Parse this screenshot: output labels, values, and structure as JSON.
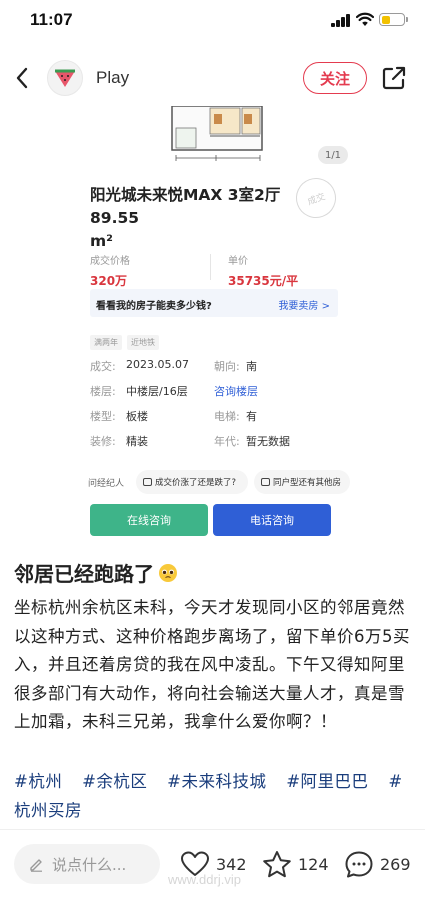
{
  "status_bar": {
    "time": "11:07",
    "battery_level": 0.38,
    "battery_color": "#f2c100"
  },
  "nav": {
    "back_icon": "chevron-left-icon",
    "avatar_icon": "watermelon-icon",
    "author": "Play",
    "follow_label": "关注",
    "share_icon": "share-icon",
    "accent_color": "#e43b4f"
  },
  "post_image": {
    "counter": "1/1",
    "title_line1": "阳光城未来悦MAX 3室2厅 89.55",
    "title_line2": "m²",
    "deal_price_label": "成交价格",
    "deal_price": "320万",
    "unit_price_label": "单价",
    "unit_price": "35735元/平",
    "banner_text": "看看我的房子能卖多少钱?",
    "banner_link": "我要卖房 >",
    "tags": [
      "满两年",
      "近地铁"
    ],
    "details": [
      {
        "label": "成交:",
        "value": "2023.05.07",
        "label2": "朝向:",
        "value2": "南"
      },
      {
        "label": "楼层:",
        "value": "中楼层/16层",
        "label2": "",
        "value2": "咨询楼层"
      },
      {
        "label": "楼型:",
        "value": "板楼",
        "label2": "电梯:",
        "value2": "有"
      },
      {
        "label": "装修:",
        "value": "精装",
        "label2": "年代:",
        "value2": "暂无数据"
      }
    ],
    "agent_label": "问经纪人",
    "chip1": "成交价涨了还是跌了?",
    "chip2": "同户型还有其他房",
    "btn_online": "在线咨询",
    "btn_phone": "电话咨询",
    "colors": {
      "price_red": "#d9363e",
      "online_green": "#3eb489",
      "phone_blue": "#2f5fd6"
    }
  },
  "post": {
    "title": "邻居已经跑路了",
    "title_emoji": "pleading-face-icon",
    "body": "坐标杭州余杭区未科，今天才发现同小区的邻居竟然以这种方式、这种价格跑步离场了，留下单价6万5买入，并且还着房贷的我在风中凌乱。下午又得知阿里很多部门有大动作，将向社会输送大量人才，真是雪上加霜，未科三兄弟，我拿什么爱你啊？！",
    "hashtags": [
      "#杭州",
      "#余杭区",
      "#未来科技城",
      "#阿里巴巴",
      "#杭州买房"
    ]
  },
  "bottom_bar": {
    "comment_placeholder": "说点什么...",
    "likes": "342",
    "favorites": "124",
    "comments": "269",
    "watermark": "www.ddrj.vip"
  }
}
